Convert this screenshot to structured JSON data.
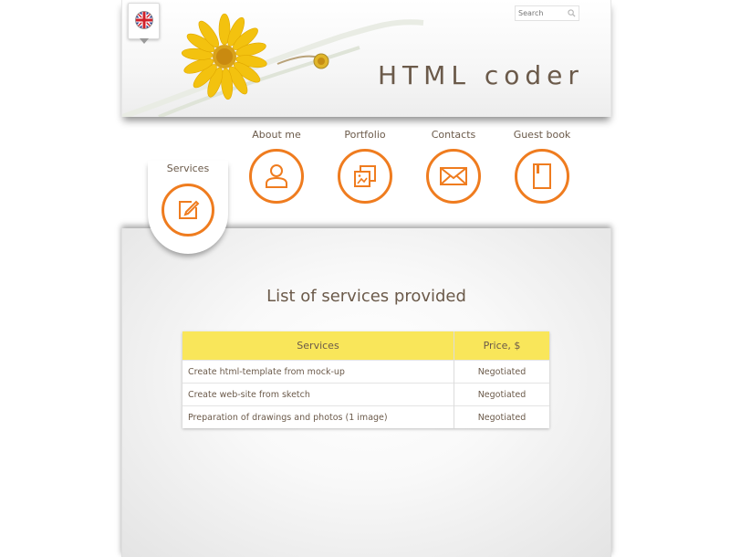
{
  "header": {
    "logo_text": "HTML coder",
    "search_placeholder": "Search",
    "language_icon": "uk-flag-icon"
  },
  "nav": {
    "items": [
      {
        "label": "Services",
        "icon": "edit-icon",
        "active": true
      },
      {
        "label": "About me",
        "icon": "user-icon",
        "active": false
      },
      {
        "label": "Portfolio",
        "icon": "gallery-icon",
        "active": false
      },
      {
        "label": "Contacts",
        "icon": "envelope-icon",
        "active": false
      },
      {
        "label": "Guest book",
        "icon": "book-icon",
        "active": false
      }
    ]
  },
  "main": {
    "title": "List of services provided",
    "table": {
      "headers": [
        "Services",
        "Price, $"
      ],
      "rows": [
        [
          "Create html-template from mock-up",
          "Negotiated"
        ],
        [
          "Create web-site from sketch",
          "Negotiated"
        ],
        [
          "Preparation of drawings and photos (1 image)",
          "Negotiated"
        ]
      ]
    }
  },
  "colors": {
    "accent": "#ef7c1f",
    "table_header": "#f9e65a",
    "text": "#6b5a4a"
  }
}
